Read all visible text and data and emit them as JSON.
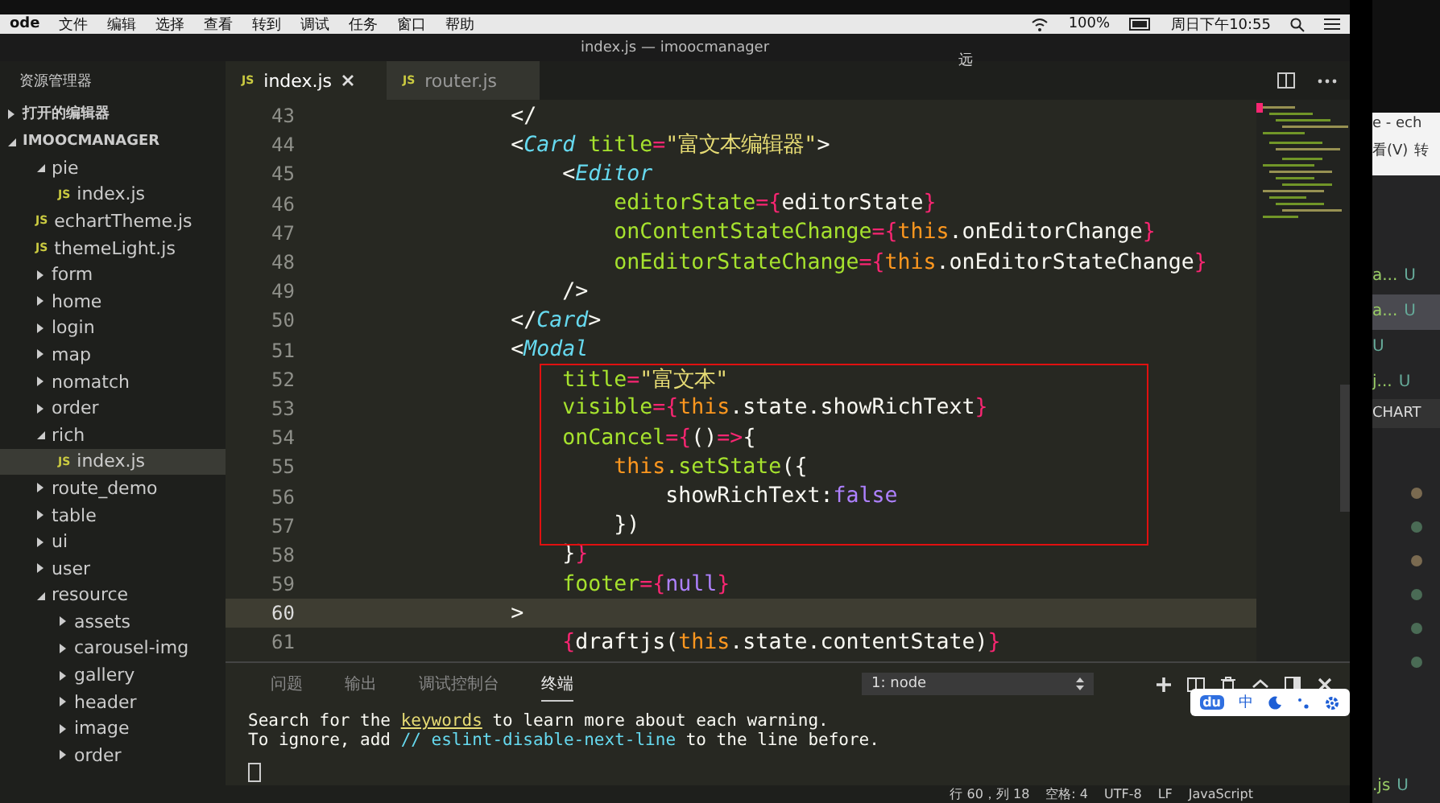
{
  "menu_bar": {
    "app": "ode",
    "items": [
      "文件",
      "编辑",
      "选择",
      "查看",
      "转到",
      "调试",
      "任务",
      "窗口",
      "帮助"
    ],
    "battery": "100%",
    "clock": "周日下午10:55"
  },
  "window": {
    "title": "index.js — imoocmanager",
    "overlay_char": "远"
  },
  "sidebar": {
    "title": "资源管理器",
    "sections": [
      {
        "label": "打开的编辑器",
        "expanded": false
      },
      {
        "label": "IMOOCMANAGER",
        "expanded": true
      }
    ],
    "tree": [
      {
        "label": "pie",
        "kind": "folder",
        "expanded": true,
        "selected": false,
        "children": [
          {
            "label": "index.js",
            "kind": "file",
            "icon": "JS",
            "selected": false
          }
        ]
      },
      {
        "label": "echartTheme.js",
        "kind": "file",
        "icon": "JS",
        "selected": false
      },
      {
        "label": "themeLight.js",
        "kind": "file",
        "icon": "JS",
        "selected": false
      },
      {
        "label": "form",
        "kind": "folder",
        "expanded": false,
        "selected": false
      },
      {
        "label": "home",
        "kind": "folder",
        "expanded": false,
        "selected": false
      },
      {
        "label": "login",
        "kind": "folder",
        "expanded": false,
        "selected": false
      },
      {
        "label": "map",
        "kind": "folder",
        "expanded": false,
        "selected": false
      },
      {
        "label": "nomatch",
        "kind": "folder",
        "expanded": false,
        "selected": false
      },
      {
        "label": "order",
        "kind": "folder",
        "expanded": false,
        "selected": false
      },
      {
        "label": "rich",
        "kind": "folder",
        "expanded": true,
        "selected": false,
        "children": [
          {
            "label": "index.js",
            "kind": "file",
            "icon": "JS",
            "selected": true
          }
        ]
      },
      {
        "label": "route_demo",
        "kind": "folder",
        "expanded": false,
        "selected": false
      },
      {
        "label": "table",
        "kind": "folder",
        "expanded": false,
        "selected": false
      },
      {
        "label": "ui",
        "kind": "folder",
        "expanded": false,
        "selected": false
      },
      {
        "label": "user",
        "kind": "folder",
        "expanded": false,
        "selected": false
      },
      {
        "label": "resource",
        "kind": "folder",
        "expanded": true,
        "selected": false,
        "children": [
          {
            "label": "assets",
            "kind": "folder",
            "expanded": false,
            "selected": false
          },
          {
            "label": "carousel-img",
            "kind": "folder",
            "expanded": false,
            "selected": false
          },
          {
            "label": "gallery",
            "kind": "folder",
            "expanded": false,
            "selected": false
          },
          {
            "label": "header",
            "kind": "folder",
            "expanded": false,
            "selected": false
          },
          {
            "label": "image",
            "kind": "folder",
            "expanded": false,
            "selected": false
          },
          {
            "label": "order",
            "kind": "folder",
            "expanded": false,
            "selected": false
          }
        ]
      }
    ]
  },
  "tabs": [
    {
      "label": "index.js",
      "icon": "JS",
      "selected": true
    },
    {
      "label": "router.js",
      "icon": "JS",
      "selected": false
    }
  ],
  "editor": {
    "lines": [
      {
        "number": "43",
        "current": false,
        "tokens": [
          {
            "kind": "plain",
            "text": "            </"
          }
        ]
      },
      {
        "number": "44",
        "current": false,
        "tokens": [
          {
            "kind": "plain",
            "text": "            <"
          },
          {
            "kind": "tag",
            "text": "Card"
          },
          {
            "kind": "attr",
            "text": " title"
          },
          {
            "kind": "op",
            "text": "="
          },
          {
            "kind": "string",
            "text": "\"富文本编辑器\""
          },
          {
            "kind": "plain",
            "text": ">"
          }
        ]
      },
      {
        "number": "45",
        "current": false,
        "tokens": [
          {
            "kind": "plain",
            "text": "                <"
          },
          {
            "kind": "tag",
            "text": "Editor"
          }
        ]
      },
      {
        "number": "46",
        "current": false,
        "tokens": [
          {
            "kind": "attr",
            "text": "                    editorState"
          },
          {
            "kind": "op",
            "text": "={"
          },
          {
            "kind": "plain",
            "text": "editorState"
          },
          {
            "kind": "op",
            "text": "}"
          }
        ]
      },
      {
        "number": "47",
        "current": false,
        "tokens": [
          {
            "kind": "attr",
            "text": "                    onContentStateChange"
          },
          {
            "kind": "op",
            "text": "={"
          },
          {
            "kind": "keyword",
            "text": "this"
          },
          {
            "kind": "plain",
            "text": ".onEditorChange"
          },
          {
            "kind": "op",
            "text": "}"
          }
        ]
      },
      {
        "number": "48",
        "current": false,
        "tokens": [
          {
            "kind": "attr",
            "text": "                    onEditorStateChange"
          },
          {
            "kind": "op",
            "text": "={"
          },
          {
            "kind": "keyword",
            "text": "this"
          },
          {
            "kind": "plain",
            "text": ".onEditorStateChange"
          },
          {
            "kind": "op",
            "text": "}"
          }
        ]
      },
      {
        "number": "49",
        "current": false,
        "tokens": [
          {
            "kind": "plain",
            "text": "                />"
          }
        ]
      },
      {
        "number": "50",
        "current": false,
        "tokens": [
          {
            "kind": "plain",
            "text": "            </"
          },
          {
            "kind": "tag",
            "text": "Card"
          },
          {
            "kind": "plain",
            "text": ">"
          }
        ]
      },
      {
        "number": "51",
        "current": false,
        "tokens": [
          {
            "kind": "plain",
            "text": "            <"
          },
          {
            "kind": "tag",
            "text": "Modal"
          }
        ]
      },
      {
        "number": "52",
        "current": false,
        "tokens": [
          {
            "kind": "attr",
            "text": "                title"
          },
          {
            "kind": "op",
            "text": "="
          },
          {
            "kind": "string",
            "text": "\"富文本\""
          }
        ]
      },
      {
        "number": "53",
        "current": false,
        "tokens": [
          {
            "kind": "attr",
            "text": "                visible"
          },
          {
            "kind": "op",
            "text": "={"
          },
          {
            "kind": "keyword",
            "text": "this"
          },
          {
            "kind": "plain",
            "text": ".state.showRichText"
          },
          {
            "kind": "op",
            "text": "}"
          }
        ]
      },
      {
        "number": "54",
        "current": false,
        "tokens": [
          {
            "kind": "attr",
            "text": "                onCancel"
          },
          {
            "kind": "op",
            "text": "={"
          },
          {
            "kind": "plain",
            "text": "()"
          },
          {
            "kind": "op",
            "text": "=>"
          },
          {
            "kind": "plain",
            "text": "{"
          }
        ]
      },
      {
        "number": "55",
        "current": false,
        "tokens": [
          {
            "kind": "keyword",
            "text": "                    this"
          },
          {
            "kind": "attr",
            "text": ".setState"
          },
          {
            "kind": "plain",
            "text": "({"
          }
        ]
      },
      {
        "number": "56",
        "current": false,
        "tokens": [
          {
            "kind": "plain",
            "text": "                        showRichText:"
          },
          {
            "kind": "constant",
            "text": "false"
          }
        ]
      },
      {
        "number": "57",
        "current": false,
        "tokens": [
          {
            "kind": "plain",
            "text": "                    })"
          }
        ]
      },
      {
        "number": "58",
        "current": false,
        "tokens": [
          {
            "kind": "plain",
            "text": "                }"
          },
          {
            "kind": "op",
            "text": "}"
          }
        ]
      },
      {
        "number": "59",
        "current": false,
        "tokens": [
          {
            "kind": "attr",
            "text": "                footer"
          },
          {
            "kind": "op",
            "text": "={"
          },
          {
            "kind": "constant",
            "text": "null"
          },
          {
            "kind": "op",
            "text": "}"
          }
        ]
      },
      {
        "number": "60",
        "current": true,
        "tokens": [
          {
            "kind": "plain",
            "text": "            >"
          }
        ]
      },
      {
        "number": "61",
        "current": false,
        "tokens": [
          {
            "kind": "op",
            "text": "                {"
          },
          {
            "kind": "plain",
            "text": "draftjs("
          },
          {
            "kind": "keyword",
            "text": "this"
          },
          {
            "kind": "plain",
            "text": ".state.contentState)"
          },
          {
            "kind": "op",
            "text": "}"
          }
        ]
      }
    ]
  },
  "panel": {
    "tabs": [
      {
        "label": "问题",
        "selected": false
      },
      {
        "label": "输出",
        "selected": false
      },
      {
        "label": "调试控制台",
        "selected": false
      },
      {
        "label": "终端",
        "selected": true
      }
    ],
    "terminal_select": "1: node",
    "ime_toolbar": {
      "logo": "du",
      "mode": "中"
    },
    "terminal_lines": [
      [
        {
          "kind": "plain",
          "text": "Search for the "
        },
        {
          "kind": "link",
          "text": "keywords"
        },
        {
          "kind": "plain",
          "text": " to learn more about each warning."
        }
      ],
      [
        {
          "kind": "plain",
          "text": "To ignore, add "
        },
        {
          "kind": "comment",
          "text": "// eslint-disable-next-line"
        },
        {
          "kind": "plain",
          "text": " to the line before."
        }
      ]
    ]
  },
  "status_bar": [
    "行 60，列 18",
    "空格: 4",
    "UTF-8",
    "LF",
    "JavaScript"
  ],
  "other_window": {
    "title": "e - ech",
    "menu": [
      "看(V)",
      "转"
    ],
    "files": [
      {
        "name": "a...",
        "status": "U",
        "selected": false
      },
      {
        "name": "a...",
        "status": "U",
        "selected": true
      },
      {
        "status": "U",
        "selected": false
      },
      {
        "name": "j...",
        "status": "U",
        "selected": false
      }
    ],
    "section": "CHART",
    "dots": [
      {
        "color": "#7a6a50"
      },
      {
        "color": "#4a6b55"
      },
      {
        "color": "#7a6a50"
      },
      {
        "color": "#4a6b55"
      },
      {
        "color": "#4a6b55"
      },
      {
        "color": "#4a6b55"
      }
    ],
    "last_file": {
      "name": ".js",
      "status": "U"
    }
  }
}
